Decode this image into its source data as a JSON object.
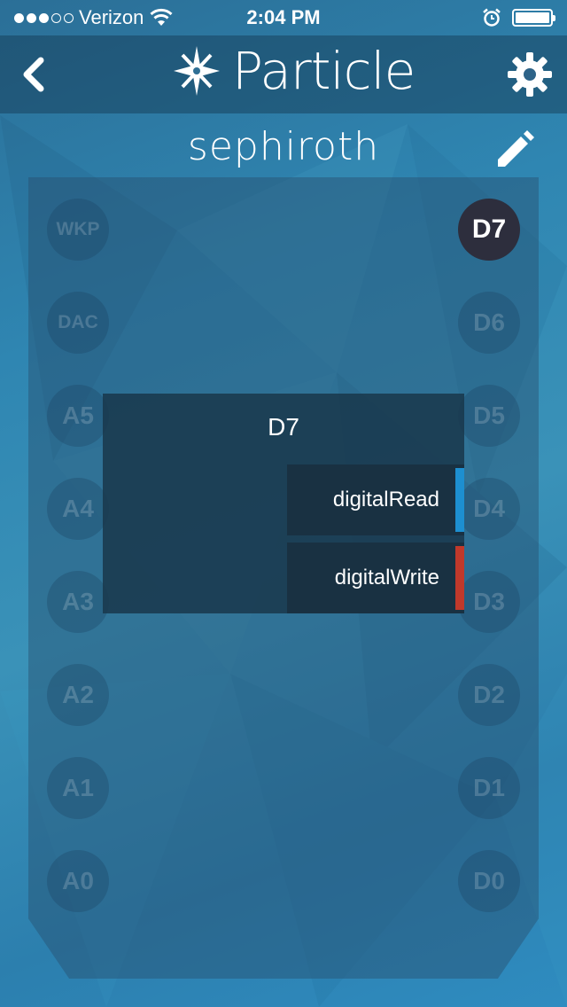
{
  "status": {
    "carrier": "Verizon",
    "time": "2:04 PM",
    "signal_dots": 5,
    "signal_filled": 3,
    "battery_level": 1.0
  },
  "nav": {
    "app_name": "Particle"
  },
  "device": {
    "name": "sephiroth"
  },
  "pins": {
    "left": [
      "WKP",
      "DAC",
      "A5",
      "A4",
      "A3",
      "A2",
      "A1",
      "A0"
    ],
    "right": [
      "D7",
      "D6",
      "D5",
      "D4",
      "D3",
      "D2",
      "D1",
      "D0"
    ],
    "active": "D7"
  },
  "popup": {
    "title": "D7",
    "functions": [
      {
        "label": "digitalRead",
        "color": "#1d8fd0"
      },
      {
        "label": "digitalWrite",
        "color": "#c0392b"
      }
    ]
  },
  "colors": {
    "active_pin": "#2d2e3d"
  }
}
